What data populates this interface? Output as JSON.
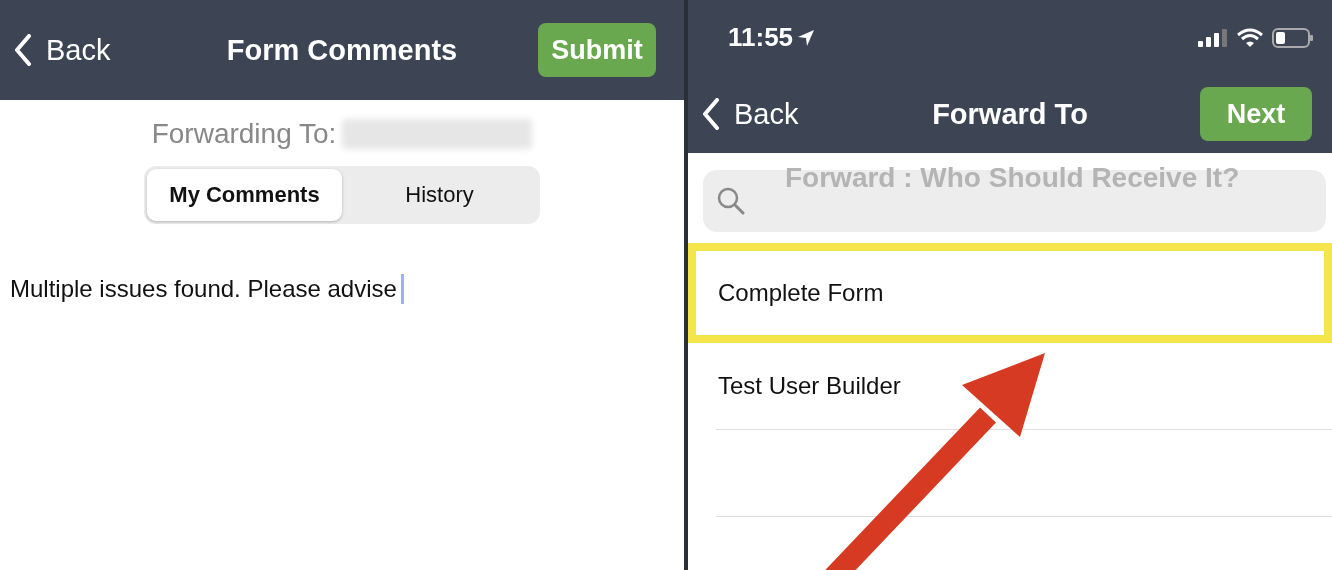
{
  "left_screen": {
    "nav": {
      "back": "Back",
      "title": "Form Comments",
      "action": "Submit"
    },
    "forwarding_label": "Forwarding To:",
    "tabs": [
      {
        "label": "My Comments",
        "selected": true
      },
      {
        "label": "History",
        "selected": false
      }
    ],
    "comment": "Multiple issues found. Please advise"
  },
  "right_screen": {
    "status_bar": {
      "time": "11:55"
    },
    "nav": {
      "back": "Back",
      "title": "Forward To",
      "action": "Next"
    },
    "ghost_title": "Forward : Who Should Receive It?",
    "recipients": [
      {
        "name": "Complete Form",
        "highlighted": true
      },
      {
        "name": "Test User Builder",
        "highlighted": false
      },
      {
        "highlighted": false
      }
    ]
  }
}
